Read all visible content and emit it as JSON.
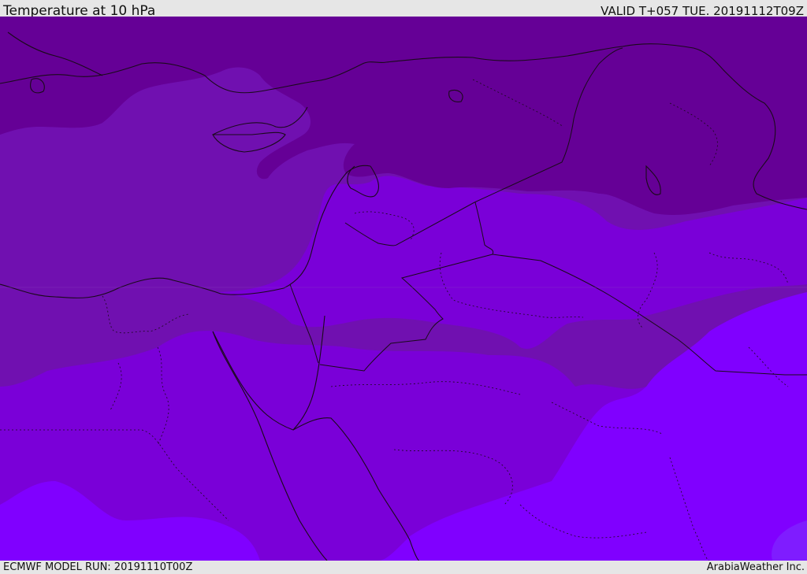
{
  "header": {
    "title": "Temperature at 10 hPa",
    "valid_time": "VALID T+057 TUE. 20191112T09Z"
  },
  "footer": {
    "model_run": "ECMWF MODEL RUN: 20191110T00Z",
    "brand": "ArabiaWeather Inc."
  },
  "colors": {
    "band_darkest": "#650096",
    "band_dark": "#7010b0",
    "band_mid": "#7a00d8",
    "band_light": "#8000ff",
    "band_lightest": "#7f1cff",
    "coastline": "#1a0a1a",
    "border": "#1a0a1a"
  }
}
